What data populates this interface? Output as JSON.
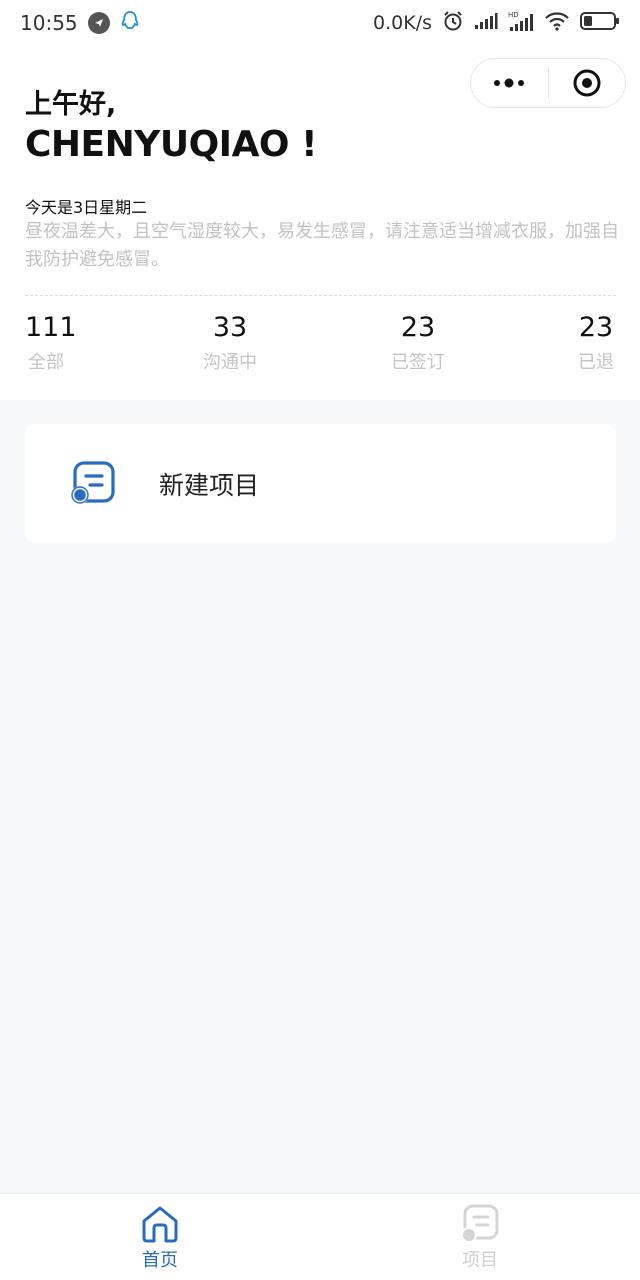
{
  "status_bar": {
    "time": "10:55",
    "network_speed": "0.0K/s",
    "icons": [
      "navigation-icon",
      "qq-icon",
      "alarm-icon",
      "signal-icon",
      "hd-signal-icon",
      "wifi-icon",
      "battery-icon"
    ]
  },
  "capsule": {
    "more_icon": "more-dots-icon",
    "close_icon": "target-icon"
  },
  "header": {
    "greeting": "上午好,",
    "username": "CHENYUQIAO !",
    "date_text": "今天是3日星期二",
    "advice": "昼夜温差大，且空气湿度较大，易发生感冒，请注意适当增减衣服，加强自我防护避免感冒。"
  },
  "stats": [
    {
      "value": "111",
      "label": "全部"
    },
    {
      "value": "33",
      "label": "沟通中"
    },
    {
      "value": "23",
      "label": "已签订"
    },
    {
      "value": "23",
      "label": "已退"
    }
  ],
  "card": {
    "icon": "project-document-icon",
    "label": "新建项目"
  },
  "tabbar": {
    "items": [
      {
        "label": "首页",
        "icon": "home-icon",
        "active": true
      },
      {
        "label": "项目",
        "icon": "project-icon",
        "active": false
      }
    ]
  },
  "colors": {
    "accent": "#2a6bc2",
    "muted_text": "#c2c2c2",
    "background": "#f7f8f9"
  }
}
